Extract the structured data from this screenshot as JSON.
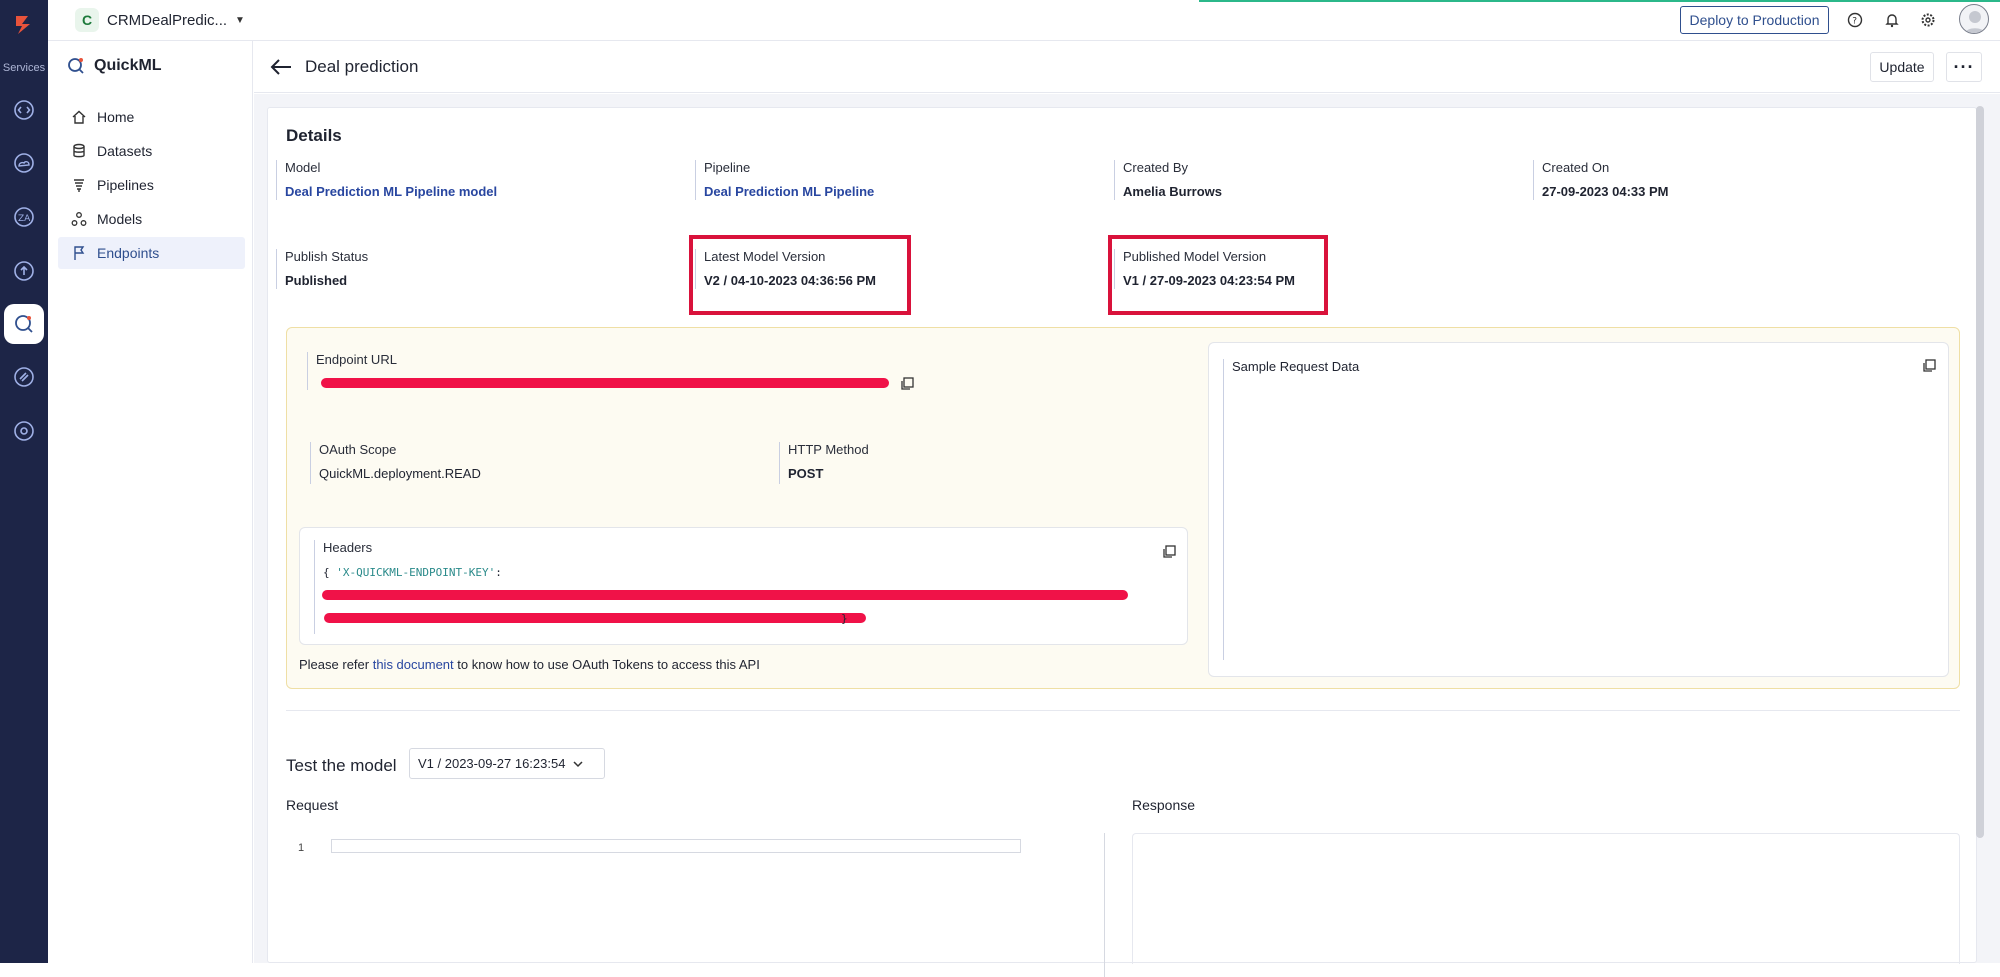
{
  "rail": {
    "services_label": "Services"
  },
  "topbar": {
    "project_initial": "C",
    "project_name": "CRMDealPredic...",
    "deploy_label": "Deploy to Production"
  },
  "sidebar": {
    "title": "QuickML",
    "items": [
      {
        "label": "Home",
        "icon": "home-icon"
      },
      {
        "label": "Datasets",
        "icon": "database-icon"
      },
      {
        "label": "Pipelines",
        "icon": "pipeline-icon"
      },
      {
        "label": "Models",
        "icon": "models-icon"
      },
      {
        "label": "Endpoints",
        "icon": "flag-icon"
      }
    ]
  },
  "page": {
    "title": "Deal prediction",
    "update_label": "Update",
    "more_label": "···"
  },
  "details": {
    "heading": "Details",
    "model": {
      "label": "Model",
      "value": "Deal Prediction ML Pipeline model"
    },
    "pipeline": {
      "label": "Pipeline",
      "value": "Deal Prediction ML Pipeline"
    },
    "created_by": {
      "label": "Created By",
      "value": "Amelia Burrows"
    },
    "created_on": {
      "label": "Created On",
      "value": "27-09-2023 04:33 PM"
    },
    "publish_status": {
      "label": "Publish Status",
      "value": "Published"
    },
    "latest_version": {
      "label": "Latest Model Version",
      "value": "V2 / 04-10-2023 04:36:56 PM"
    },
    "published_version": {
      "label": "Published Model Version",
      "value": "V1 / 27-09-2023 04:23:54 PM"
    }
  },
  "endpoint": {
    "url_label": "Endpoint URL",
    "oauth_label": "OAuth Scope",
    "oauth_value": "QuickML.deployment.READ",
    "method_label": "HTTP Method",
    "method_value": "POST",
    "headers_label": "Headers",
    "headers_open": "{",
    "headers_key": "'X-QUICKML-ENDPOINT-KEY'",
    "headers_colon": ":",
    "headers_close": "}",
    "refer_prefix": "Please refer",
    "refer_link": "this document",
    "refer_suffix": "to know how to use OAuth Tokens to access this API",
    "sample_label": "Sample Request Data"
  },
  "test": {
    "heading": "Test the model",
    "version_selected": "V1 / 2023-09-27 16:23:54",
    "request_label": "Request",
    "response_label": "Response",
    "line_number": "1"
  },
  "colors": {
    "rail": "#1d2547",
    "accent": "#2846a0",
    "highlight": "#d9123b",
    "redaction": "#f01248",
    "endpoint_bg": "#fdfbf2"
  }
}
